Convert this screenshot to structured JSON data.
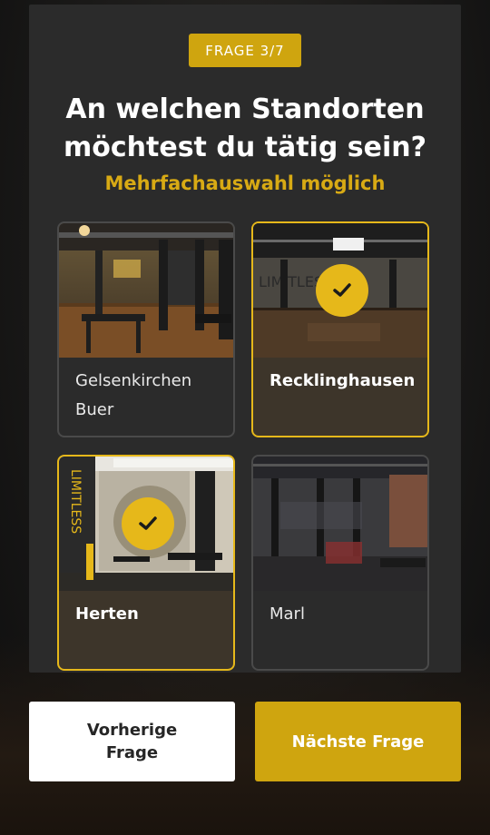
{
  "quiz": {
    "progress_label": "FRAGE 3/7",
    "question": "An welchen Standorten\nmöchtest du tätig sein?",
    "hint": "Mehrfachauswahl möglich"
  },
  "options": [
    {
      "label": "Gelsenkirchen Buer",
      "selected": false
    },
    {
      "label": "Recklinghausen",
      "selected": true
    },
    {
      "label": "Herten",
      "selected": true
    },
    {
      "label": "Marl",
      "selected": false
    }
  ],
  "footer": {
    "prev_label": "Vorherige\nFrage",
    "next_label": "Nächste Frage"
  },
  "colors": {
    "accent": "#cfa50f",
    "selected_border": "#e6b81a",
    "card": "#2b2b2b"
  },
  "icons": {
    "check": "check-icon"
  }
}
